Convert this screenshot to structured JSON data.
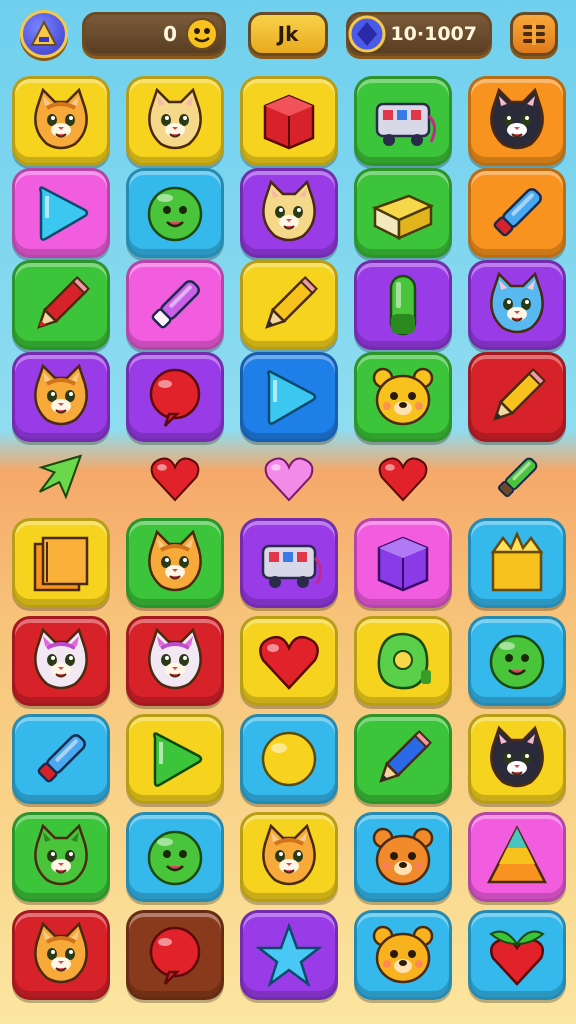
{
  "hud": {
    "score": "0",
    "center_label": "Jk",
    "coins": "10·1007"
  },
  "colors": {
    "yellow": "#f6d31e",
    "green": "#3cc43a",
    "red": "#d8222a",
    "orange": "#f7931e",
    "pink": "#f25de0",
    "cyan": "#35b8ec",
    "purple": "#9a3be8",
    "blue": "#1f7fe8",
    "brown": "#8a3a1c"
  },
  "upper_grid": [
    [
      {
        "bg": "yellow",
        "icon": "cat-orange-icon"
      },
      {
        "bg": "yellow",
        "icon": "cat-cream-icon"
      },
      {
        "bg": "yellow",
        "icon": "red-cube-icon"
      },
      {
        "bg": "green",
        "icon": "toy-bus-icon"
      },
      {
        "bg": "orange",
        "icon": "cat-tuxedo-icon"
      }
    ],
    [
      {
        "bg": "pink",
        "icon": "cyan-triangle-icon"
      },
      {
        "bg": "cyan",
        "icon": "green-blob-icon"
      },
      {
        "bg": "purple",
        "icon": "cat-cream-icon"
      },
      {
        "bg": "green",
        "icon": "yellow-book-icon"
      },
      {
        "bg": "orange",
        "icon": "blue-marker-icon"
      }
    ],
    [
      {
        "bg": "green",
        "icon": "red-crayon-icon"
      },
      {
        "bg": "pink",
        "icon": "purple-marker-icon"
      },
      {
        "bg": "yellow",
        "icon": "yellow-pencil-icon"
      },
      {
        "bg": "purple",
        "icon": "green-capsule-icon"
      },
      {
        "bg": "purple",
        "icon": "cat-blue-icon"
      }
    ],
    [
      {
        "bg": "purple",
        "icon": "cat-orange-icon"
      },
      {
        "bg": "purple",
        "icon": "red-balloon-icon"
      },
      {
        "bg": "blue",
        "icon": "cyan-triangle-icon"
      },
      {
        "bg": "green",
        "icon": "yellow-face-icon"
      },
      {
        "bg": "red",
        "icon": "yellow-pencil-icon"
      }
    ]
  ],
  "bonus_row": [
    "green-arrow-icon",
    "red-heart-icon",
    "pink-heart-icon",
    "red-heart-icon",
    "green-marker-icon"
  ],
  "lower_grid": [
    [
      {
        "bg": "yellow",
        "icon": "orange-book-icon"
      },
      {
        "bg": "green",
        "icon": "cat-orange-icon"
      },
      {
        "bg": "purple",
        "icon": "toy-bus-icon"
      },
      {
        "bg": "pink",
        "icon": "purple-cube-icon"
      },
      {
        "bg": "cyan",
        "icon": "yellow-crown-box-icon"
      }
    ],
    [
      {
        "bg": "red",
        "icon": "cat-pink-icon"
      },
      {
        "bg": "red",
        "icon": "cat-pink-icon"
      },
      {
        "bg": "yellow",
        "icon": "red-heart-icon"
      },
      {
        "bg": "yellow",
        "icon": "green-ring-icon"
      },
      {
        "bg": "cyan",
        "icon": "green-blob-icon"
      }
    ],
    [
      {
        "bg": "cyan",
        "icon": "blue-marker-icon"
      },
      {
        "bg": "yellow",
        "icon": "green-triangle-icon"
      },
      {
        "bg": "cyan",
        "icon": "yellow-ball-icon"
      },
      {
        "bg": "green",
        "icon": "blue-pencil-icon"
      },
      {
        "bg": "yellow",
        "icon": "cat-tuxedo-icon"
      }
    ],
    [
      {
        "bg": "green",
        "icon": "cat-green-icon"
      },
      {
        "bg": "cyan",
        "icon": "green-blob-icon"
      },
      {
        "bg": "yellow",
        "icon": "cat-orange-icon"
      },
      {
        "bg": "cyan",
        "icon": "orange-bear-icon"
      },
      {
        "bg": "pink",
        "icon": "candy-corn-icon"
      }
    ],
    [
      {
        "bg": "red",
        "icon": "cat-orange-icon"
      },
      {
        "bg": "brown",
        "icon": "red-balloon-icon"
      },
      {
        "bg": "purple",
        "icon": "cyan-star-icon"
      },
      {
        "bg": "cyan",
        "icon": "yellow-bear-icon"
      },
      {
        "bg": "cyan",
        "icon": "heart-fruit-icon"
      }
    ]
  ]
}
